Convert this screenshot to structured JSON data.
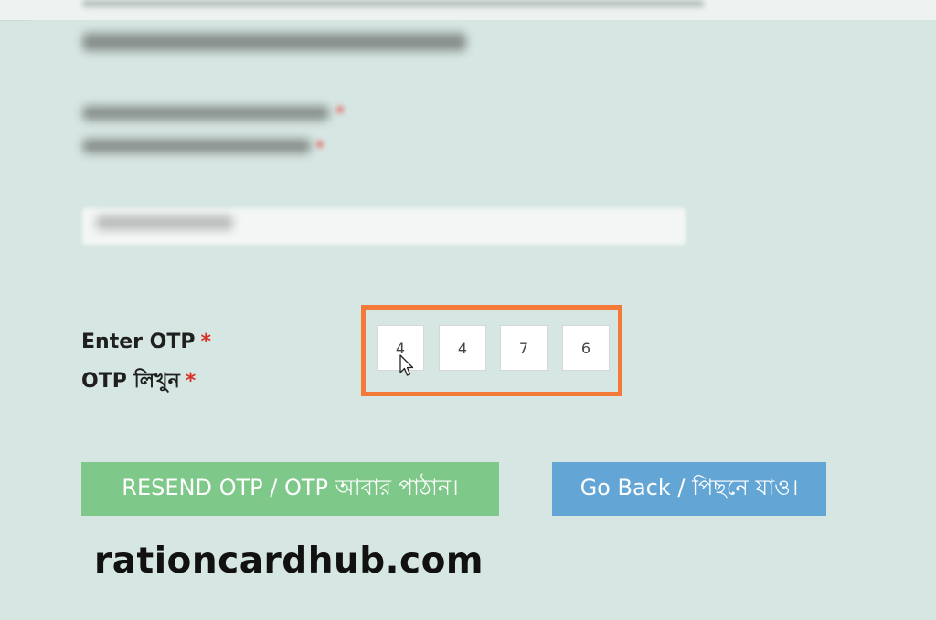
{
  "otp": {
    "label_en": "Enter OTP",
    "label_bn": "OTP লিখুন",
    "required_mark": "*",
    "digits": [
      "4",
      "4",
      "7",
      "6"
    ]
  },
  "buttons": {
    "resend_label": "RESEND OTP / OTP আবার পাঠান।",
    "back_label": "Go Back / পিছনে যাও।"
  },
  "watermark": "rationcardhub.com",
  "colors": {
    "background": "#d6e6e2",
    "highlight_frame": "#f47a3a",
    "resend_button": "#7ec88a",
    "back_button": "#63a6d5",
    "required_star": "#d9322a"
  },
  "icons": {
    "cursor": "mouse-pointer-icon"
  }
}
